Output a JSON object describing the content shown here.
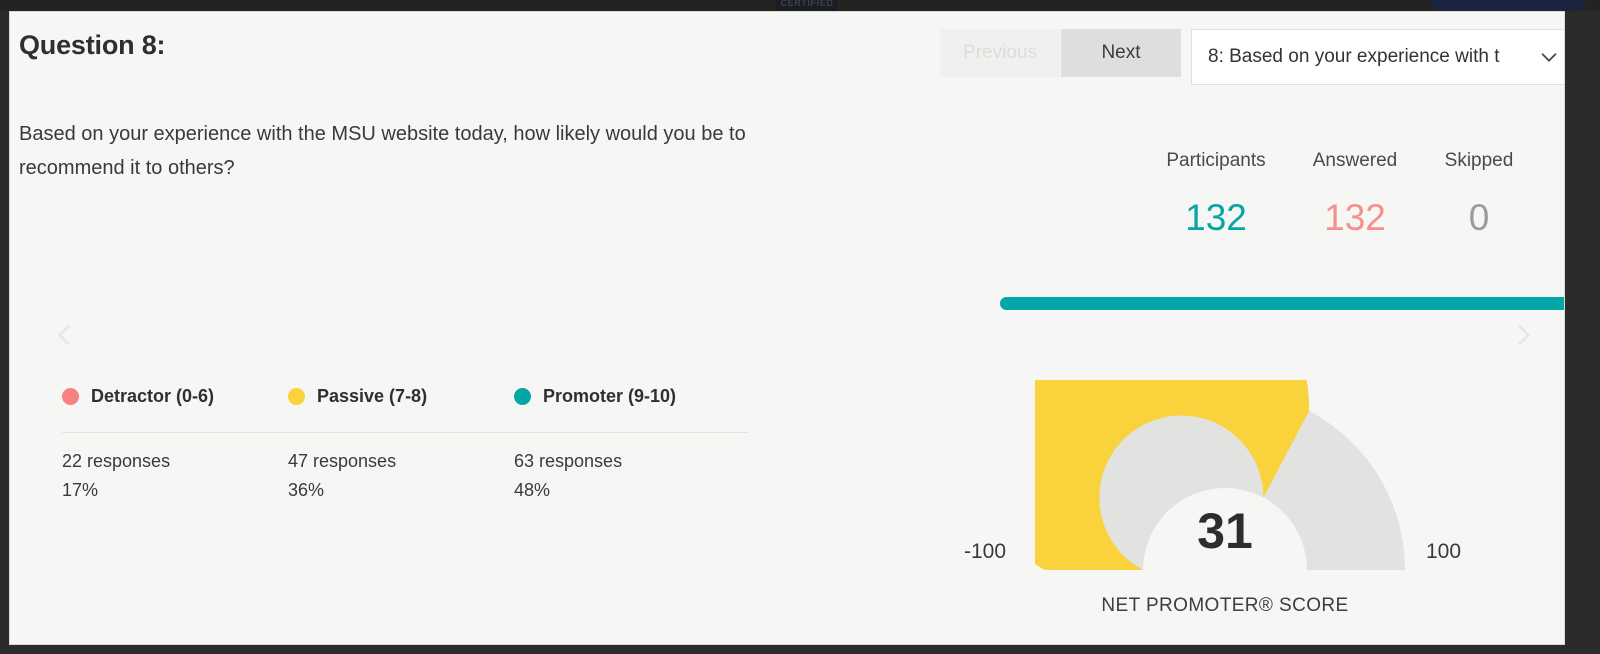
{
  "browser_chrome": {
    "certified_badge_text": "CERTIFIED",
    "topbar_bg": "#232323"
  },
  "header": {
    "question_title": "Question 8:",
    "question_text": "Based on your experience with the MSU website today, how likely would you be to recommend it to others?"
  },
  "nav": {
    "previous_label": "Previous",
    "next_label": "Next",
    "previous_disabled": true,
    "question_select_value": "8: Based on your experience with t",
    "chevron_icon": "chevron-down-icon",
    "prev_arrow_icon": "chevron-left-icon",
    "next_arrow_icon": "chevron-right-icon"
  },
  "stats": {
    "participants_label": "Participants",
    "participants_value": "132",
    "participants_color": "#09a5a5",
    "answered_label": "Answered",
    "answered_value": "132",
    "answered_color": "#f5918d",
    "skipped_label": "Skipped",
    "skipped_value": "0",
    "skipped_color": "#9b9b9b",
    "progress_percent": "100",
    "progress_color": "#03a6a6"
  },
  "legend": [
    {
      "label": "Detractor (0-6)",
      "color": "#f8827f",
      "responses": "22 responses",
      "percent": "17%"
    },
    {
      "label": "Passive (7-8)",
      "color": "#fad23c",
      "responses": "47 responses",
      "percent": "36%"
    },
    {
      "label": "Promoter (9-10)",
      "color": "#03a6a6",
      "responses": "63 responses",
      "percent": "48%"
    }
  ],
  "gauge": {
    "value": "31",
    "min_label": "-100",
    "max_label": "100",
    "caption": "NET PROMOTER® SCORE",
    "fill_color": "#fad23c",
    "track_color": "#e2e2e0"
  },
  "chart_data": {
    "type": "pie",
    "title": "NET PROMOTER® SCORE",
    "subtitle": "Based on your experience with the MSU website today, how likely would you be to recommend it to others?",
    "categories": [
      "Detractor (0-6)",
      "Passive (7-8)",
      "Promoter (9-10)"
    ],
    "values": [
      22,
      47,
      63
    ],
    "percents": [
      17,
      36,
      48
    ],
    "colors": [
      "#f8827f",
      "#fad23c",
      "#03a6a6"
    ],
    "total_responses": 132,
    "gauge": {
      "type": "gauge",
      "score": 31,
      "range": [
        -100,
        100
      ],
      "fill_color": "#fad23c",
      "track_color": "#e2e2e0",
      "label": "NET PROMOTER® SCORE"
    },
    "legend_position": "top-left",
    "grid": false
  }
}
